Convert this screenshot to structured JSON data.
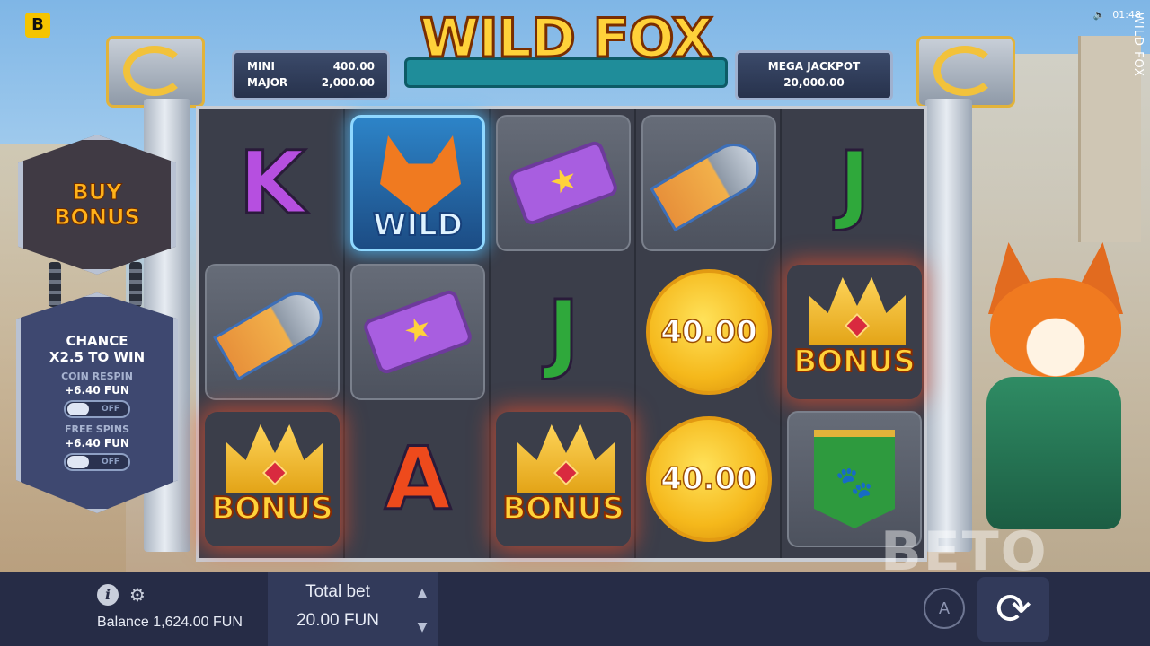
{
  "brand": {
    "logo_letter": "B"
  },
  "topbar": {
    "time": "01:48",
    "sound_icon": "speaker-icon"
  },
  "game": {
    "title": "WILD FOX",
    "side_title": "WILD FOX"
  },
  "jackpots": {
    "mini_label": "MINI",
    "mini_value": "400.00",
    "major_label": "MAJOR",
    "major_value": "2,000.00",
    "mega_label": "MEGA JACKPOT",
    "mega_value": "20,000.00"
  },
  "side_panel": {
    "buy_bonus_line1": "BUY",
    "buy_bonus_line2": "BONUS",
    "chance_line1": "CHANCE",
    "chance_line2": "X2.5 TO WIN",
    "coin_respin_label": "COIN RESPIN",
    "coin_respin_value": "+6.40 FUN",
    "coin_respin_toggle": "OFF",
    "free_spins_label": "FREE SPINS",
    "free_spins_value": "+6.40 FUN",
    "free_spins_toggle": "OFF"
  },
  "reels": {
    "r1": {
      "s1": "K",
      "s3": "BONUS"
    },
    "r2": {
      "s1": "WILD",
      "s3": "A"
    },
    "r3": {
      "s2": "J",
      "s3": "BONUS"
    },
    "r4": {
      "s2": "40.00",
      "s3": "40.00"
    },
    "r5": {
      "s1": "J",
      "s2": "BONUS"
    }
  },
  "watermark": "BETO",
  "bottom": {
    "info_label": "i",
    "balance_label": "Balance",
    "balance_value": "1,624.00 FUN",
    "total_bet_label": "Total bet",
    "total_bet_value": "20.00 FUN",
    "auto_label": "A",
    "spin_glyph": "⟳"
  }
}
